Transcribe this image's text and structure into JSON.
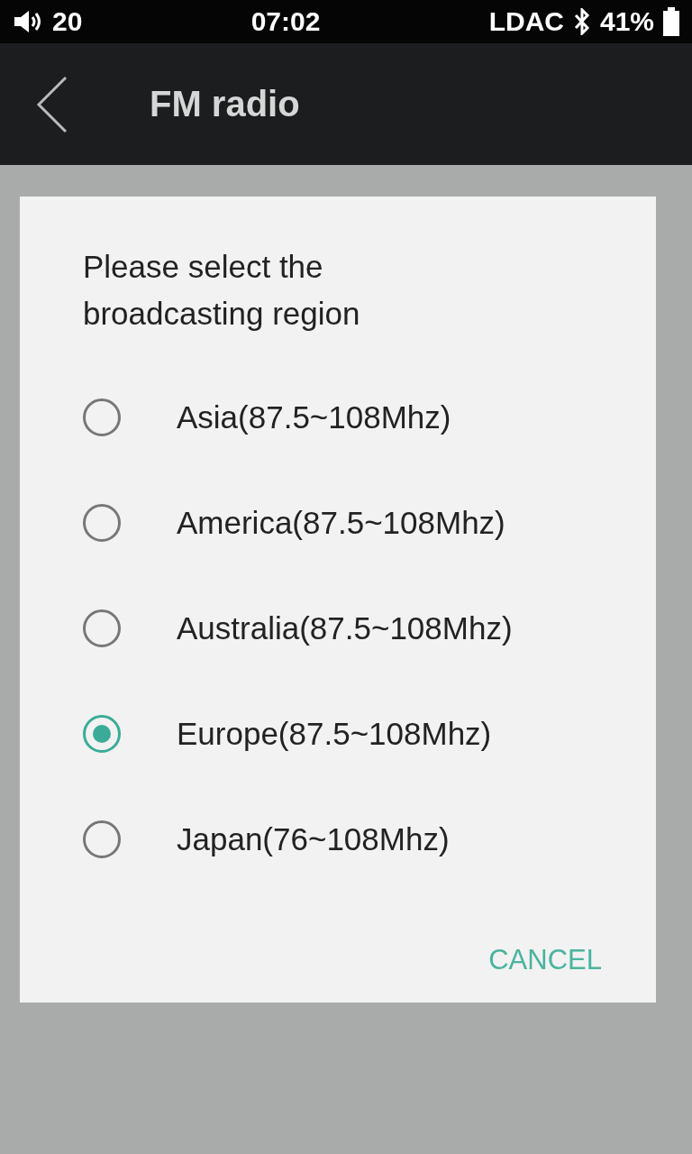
{
  "status_bar": {
    "volume": "20",
    "time": "07:02",
    "codec": "LDAC",
    "battery": "41%"
  },
  "app_bar": {
    "title": "FM radio"
  },
  "dialog": {
    "title": "Please select the broadcasting region",
    "options": [
      {
        "label": "Asia(87.5~108Mhz)",
        "selected": false
      },
      {
        "label": "America(87.5~108Mhz)",
        "selected": false
      },
      {
        "label": "Australia(87.5~108Mhz)",
        "selected": false
      },
      {
        "label": "Europe(87.5~108Mhz)",
        "selected": true
      },
      {
        "label": "Japan(76~108Mhz)",
        "selected": false
      }
    ],
    "buttons": [
      "CANCEL"
    ]
  }
}
